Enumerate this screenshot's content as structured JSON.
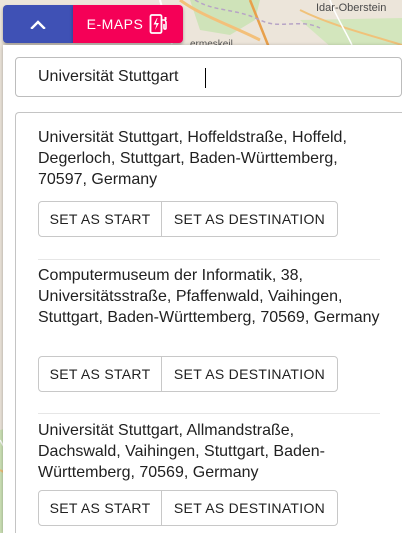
{
  "map": {
    "label_idar": "Idar-Oberstein",
    "label_meskeil": "ermeskeil"
  },
  "toolbar": {
    "collapse_icon": "chevron-up-icon",
    "emaps_label": "E-MAPS",
    "emaps_icon": "ev-charging-icon"
  },
  "search": {
    "value": "Universität Stuttgart",
    "placeholder": ""
  },
  "results": [
    {
      "address": "Universität Stuttgart, Hoffeldstraße, Hoffeld, Degerloch, Stuttgart, Baden-Württemberg, 70597, Germany",
      "start_label": "SET AS START",
      "destination_label": "SET AS DESTINATION"
    },
    {
      "address": "Computermuseum der Informatik, 38, Universitätsstraße, Pfaffenwald, Vaihingen, Stuttgart, Baden-Württemberg, 70569, Germany",
      "start_label": "SET AS START",
      "destination_label": "SET AS DESTINATION"
    },
    {
      "address": "Universität Stuttgart, Allmandstraße, Dachswald, Vaihingen, Stuttgart, Baden-Württemberg, 70569, Germany",
      "start_label": "SET AS START",
      "destination_label": "SET AS DESTINATION"
    }
  ],
  "colors": {
    "collapse_button": "#3f51b5",
    "emaps_button": "#f50057"
  }
}
